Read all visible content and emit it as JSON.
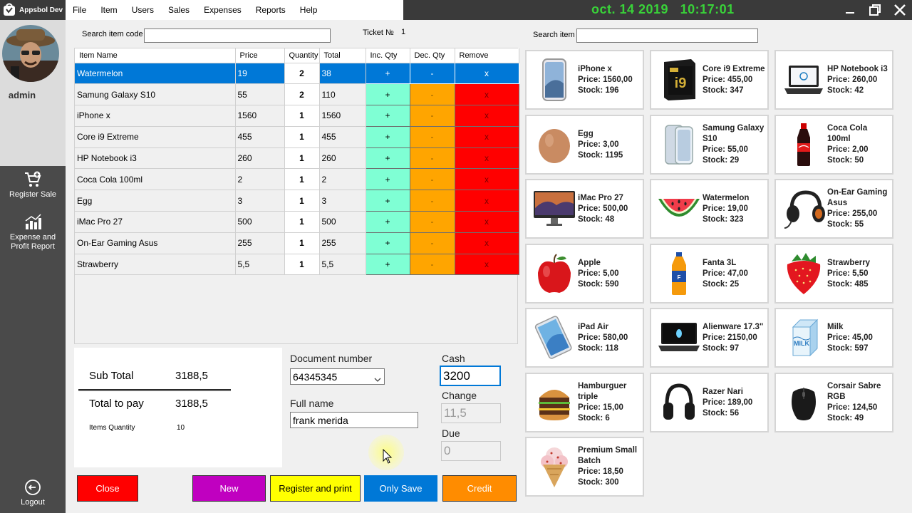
{
  "app": {
    "brand": "Appsbol Dev",
    "datetime": "oct. 14 2019   10:17:01",
    "menu": [
      "File",
      "Item",
      "Users",
      "Sales",
      "Expenses",
      "Reports",
      "Help"
    ]
  },
  "sidebar": {
    "username": "admin",
    "register_sale": "Register Sale",
    "report_line1": "Expense and",
    "report_line2": "Profit Report",
    "logout": "Logout"
  },
  "header": {
    "search_code_label": "Search item code",
    "ticket_label": "Ticket №",
    "ticket_number": "1",
    "search_item_label": "Search item"
  },
  "cart": {
    "columns": [
      "Item Name",
      "Price",
      "Quantity",
      "Total",
      "Inc. Qty",
      "Dec. Qty",
      "Remove"
    ],
    "inc_symbol": "+",
    "dec_symbol": "-",
    "remove_symbol": "x",
    "rows": [
      {
        "name": "Watermelon",
        "price": "19",
        "qty": "2",
        "total": "38",
        "selected": true
      },
      {
        "name": "Samung Galaxy S10",
        "price": "55",
        "qty": "2",
        "total": "110"
      },
      {
        "name": "iPhone x",
        "price": "1560",
        "qty": "1",
        "total": "1560"
      },
      {
        "name": "Core i9 Extreme",
        "price": "455",
        "qty": "1",
        "total": "455"
      },
      {
        "name": "HP Notebook i3",
        "price": "260",
        "qty": "1",
        "total": "260"
      },
      {
        "name": "Coca Cola 100ml",
        "price": "2",
        "qty": "1",
        "total": "2"
      },
      {
        "name": "Egg",
        "price": "3",
        "qty": "1",
        "total": "3"
      },
      {
        "name": "iMac Pro 27",
        "price": "500",
        "qty": "1",
        "total": "500"
      },
      {
        "name": "On-Ear Gaming Asus",
        "price": "255",
        "qty": "1",
        "total": "255"
      },
      {
        "name": "Strawberry",
        "price": "5,5",
        "qty": "1",
        "total": "5,5"
      }
    ]
  },
  "summary": {
    "subtotal_label": "Sub Total",
    "subtotal_value": "3188,5",
    "topay_label": "Total to pay",
    "topay_value": "3188,5",
    "qty_label": "Items Quantity",
    "qty_value": "10"
  },
  "payment": {
    "doc_label": "Document number",
    "doc_value": "64345345",
    "fullname_label": "Full name",
    "fullname_value": "frank merida",
    "cash_label": "Cash",
    "cash_value": "3200",
    "change_label": "Change",
    "change_value": "11,5",
    "due_label": "Due",
    "due_value": "0"
  },
  "actions": {
    "close": "Close",
    "new": "New",
    "register_print": "Register and print",
    "only_save": "Only Save",
    "credit": "Credit"
  },
  "products": [
    {
      "name": "iPhone x",
      "price": "Price: 1560,00",
      "stock": "Stock: 196",
      "icon": "iphone-icon"
    },
    {
      "name": "Core i9 Extreme",
      "price": "Price: 455,00",
      "stock": "Stock: 347",
      "icon": "cpu-box-icon"
    },
    {
      "name": "HP Notebook i3",
      "price": "Price: 260,00",
      "stock": "Stock: 42",
      "icon": "laptop-icon"
    },
    {
      "name": "Egg",
      "price": "Price: 3,00",
      "stock": "Stock: 1195",
      "icon": "egg-icon"
    },
    {
      "name": "Samung Galaxy S10",
      "price": "Price: 55,00",
      "stock": "Stock: 29",
      "icon": "galaxy-phone-icon"
    },
    {
      "name": "Coca Cola 100ml",
      "price": "Price: 2,00",
      "stock": "Stock: 50",
      "icon": "cola-bottle-icon"
    },
    {
      "name": "iMac Pro 27",
      "price": "Price: 500,00",
      "stock": "Stock: 48",
      "icon": "imac-icon"
    },
    {
      "name": "Watermelon",
      "price": "Price: 19,00",
      "stock": "Stock: 323",
      "icon": "watermelon-icon"
    },
    {
      "name": "On-Ear Gaming Asus",
      "price": "Price: 255,00",
      "stock": "Stock: 55",
      "icon": "headset-icon"
    },
    {
      "name": "Apple",
      "price": "Price: 5,00",
      "stock": "Stock: 590",
      "icon": "apple-icon"
    },
    {
      "name": "Fanta 3L",
      "price": "Price: 47,00",
      "stock": "Stock: 25",
      "icon": "fanta-bottle-icon"
    },
    {
      "name": "Strawberry",
      "price": "Price: 5,50",
      "stock": "Stock: 485",
      "icon": "strawberry-icon"
    },
    {
      "name": "iPad Air",
      "price": "Price: 580,00",
      "stock": "Stock: 118",
      "icon": "tablet-icon"
    },
    {
      "name": "Alienware 17.3\"",
      "price": "Price: 2150,00",
      "stock": "Stock: 97",
      "icon": "gaming-laptop-icon"
    },
    {
      "name": "Milk",
      "price": "Price: 45,00",
      "stock": "Stock: 597",
      "icon": "milk-carton-icon"
    },
    {
      "name": "Hamburguer triple",
      "price": "Price: 15,00",
      "stock": "Stock: 6",
      "icon": "burger-icon"
    },
    {
      "name": "Razer Nari",
      "price": "Price: 189,00",
      "stock": "Stock: 56",
      "icon": "headphones-icon"
    },
    {
      "name": "Corsair Sabre RGB",
      "price": "Price: 124,50",
      "stock": "Stock: 49",
      "icon": "mouse-icon"
    },
    {
      "name": "Premium Small Batch",
      "price": "Price: 18,50",
      "stock": "Stock: 300",
      "icon": "ice-cream-icon"
    }
  ],
  "colors": {
    "selected_row": "#0078d7",
    "inc": "#7fffd4",
    "dec": "#ffa500",
    "remove": "#ff0000",
    "datetime": "#39d239",
    "close_btn": "#ff0000",
    "new_btn": "#c000c0",
    "register_btn": "#ffff00",
    "save_btn": "#0078d7",
    "credit_btn": "#ff8c00"
  }
}
